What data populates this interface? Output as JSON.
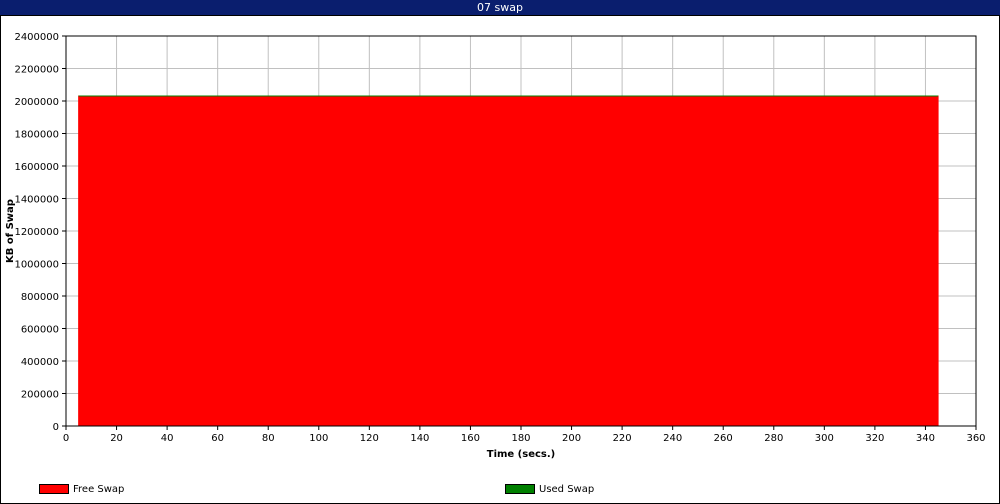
{
  "window": {
    "title": "07 swap"
  },
  "colors": {
    "title_bar": "#0a1e6e",
    "free": "#ff0000",
    "used": "#008000",
    "grid": "#c0c0c0"
  },
  "chart_data": {
    "type": "area",
    "xlabel": "Time (secs.)",
    "ylabel": "KB of Swap",
    "xlim": [
      0,
      360
    ],
    "ylim": [
      0,
      2400000
    ],
    "x_ticks": [
      0,
      20,
      40,
      60,
      80,
      100,
      120,
      140,
      160,
      180,
      200,
      220,
      240,
      260,
      280,
      300,
      320,
      340,
      360
    ],
    "y_ticks": [
      0,
      200000,
      400000,
      600000,
      800000,
      1000000,
      1200000,
      1400000,
      1600000,
      1800000,
      2000000,
      2200000,
      2400000
    ],
    "grid": true,
    "stacked": true,
    "x": [
      5,
      345
    ],
    "series": [
      {
        "name": "Free Swap",
        "color": "#ff0000",
        "values": [
          2031000,
          2031000
        ]
      },
      {
        "name": "Used Swap",
        "color": "#008000",
        "values": [
          0,
          0
        ]
      }
    ],
    "legend_position": "bottom"
  }
}
